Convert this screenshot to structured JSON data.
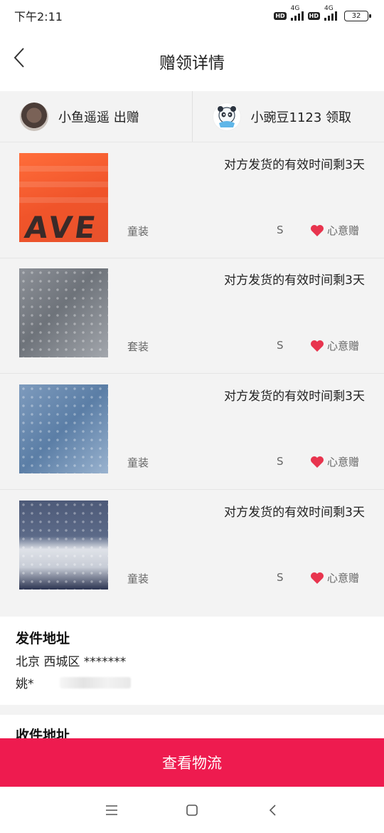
{
  "status_bar": {
    "time": "下午2:11",
    "network1": "4G",
    "network2": "4G",
    "hd": "HD",
    "battery": "32"
  },
  "header": {
    "title": "赠领详情",
    "back_icon": "chevron-left-icon"
  },
  "parties": {
    "giver": {
      "name": "小鱼遥遥 出赠"
    },
    "receiver": {
      "name": "小豌豆1123 领取"
    }
  },
  "items": [
    {
      "note": "对方发货的有效时间剩3天",
      "category": "童装",
      "size": "S",
      "tag": "心意赠"
    },
    {
      "note": "对方发货的有效时间剩3天",
      "category": "套装",
      "size": "S",
      "tag": "心意赠"
    },
    {
      "note": "对方发货的有效时间剩3天",
      "category": "童装",
      "size": "S",
      "tag": "心意赠"
    },
    {
      "note": "对方发货的有效时间剩3天",
      "category": "童装",
      "size": "S",
      "tag": "心意赠"
    }
  ],
  "ship_address": {
    "title": "发件地址",
    "line": "北京 西城区 *******",
    "name": "姚*"
  },
  "receive_address": {
    "title": "收件地址"
  },
  "action": {
    "logistics_label": "查看物流"
  },
  "colors": {
    "accent": "#ee1b4f",
    "heart": "#e8344e",
    "background_gray": "#f3f3f3"
  }
}
